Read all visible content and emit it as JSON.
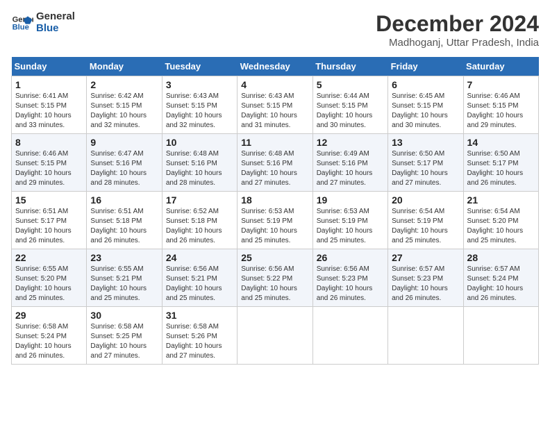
{
  "header": {
    "logo_line1": "General",
    "logo_line2": "Blue",
    "month_title": "December 2024",
    "location": "Madhoganj, Uttar Pradesh, India"
  },
  "weekdays": [
    "Sunday",
    "Monday",
    "Tuesday",
    "Wednesday",
    "Thursday",
    "Friday",
    "Saturday"
  ],
  "weeks": [
    [
      {
        "day": "1",
        "sunrise": "6:41 AM",
        "sunset": "5:15 PM",
        "daylight": "10 hours and 33 minutes."
      },
      {
        "day": "2",
        "sunrise": "6:42 AM",
        "sunset": "5:15 PM",
        "daylight": "10 hours and 32 minutes."
      },
      {
        "day": "3",
        "sunrise": "6:43 AM",
        "sunset": "5:15 PM",
        "daylight": "10 hours and 32 minutes."
      },
      {
        "day": "4",
        "sunrise": "6:43 AM",
        "sunset": "5:15 PM",
        "daylight": "10 hours and 31 minutes."
      },
      {
        "day": "5",
        "sunrise": "6:44 AM",
        "sunset": "5:15 PM",
        "daylight": "10 hours and 30 minutes."
      },
      {
        "day": "6",
        "sunrise": "6:45 AM",
        "sunset": "5:15 PM",
        "daylight": "10 hours and 30 minutes."
      },
      {
        "day": "7",
        "sunrise": "6:46 AM",
        "sunset": "5:15 PM",
        "daylight": "10 hours and 29 minutes."
      }
    ],
    [
      {
        "day": "8",
        "sunrise": "6:46 AM",
        "sunset": "5:15 PM",
        "daylight": "10 hours and 29 minutes."
      },
      {
        "day": "9",
        "sunrise": "6:47 AM",
        "sunset": "5:16 PM",
        "daylight": "10 hours and 28 minutes."
      },
      {
        "day": "10",
        "sunrise": "6:48 AM",
        "sunset": "5:16 PM",
        "daylight": "10 hours and 28 minutes."
      },
      {
        "day": "11",
        "sunrise": "6:48 AM",
        "sunset": "5:16 PM",
        "daylight": "10 hours and 27 minutes."
      },
      {
        "day": "12",
        "sunrise": "6:49 AM",
        "sunset": "5:16 PM",
        "daylight": "10 hours and 27 minutes."
      },
      {
        "day": "13",
        "sunrise": "6:50 AM",
        "sunset": "5:17 PM",
        "daylight": "10 hours and 27 minutes."
      },
      {
        "day": "14",
        "sunrise": "6:50 AM",
        "sunset": "5:17 PM",
        "daylight": "10 hours and 26 minutes."
      }
    ],
    [
      {
        "day": "15",
        "sunrise": "6:51 AM",
        "sunset": "5:17 PM",
        "daylight": "10 hours and 26 minutes."
      },
      {
        "day": "16",
        "sunrise": "6:51 AM",
        "sunset": "5:18 PM",
        "daylight": "10 hours and 26 minutes."
      },
      {
        "day": "17",
        "sunrise": "6:52 AM",
        "sunset": "5:18 PM",
        "daylight": "10 hours and 26 minutes."
      },
      {
        "day": "18",
        "sunrise": "6:53 AM",
        "sunset": "5:19 PM",
        "daylight": "10 hours and 25 minutes."
      },
      {
        "day": "19",
        "sunrise": "6:53 AM",
        "sunset": "5:19 PM",
        "daylight": "10 hours and 25 minutes."
      },
      {
        "day": "20",
        "sunrise": "6:54 AM",
        "sunset": "5:19 PM",
        "daylight": "10 hours and 25 minutes."
      },
      {
        "day": "21",
        "sunrise": "6:54 AM",
        "sunset": "5:20 PM",
        "daylight": "10 hours and 25 minutes."
      }
    ],
    [
      {
        "day": "22",
        "sunrise": "6:55 AM",
        "sunset": "5:20 PM",
        "daylight": "10 hours and 25 minutes."
      },
      {
        "day": "23",
        "sunrise": "6:55 AM",
        "sunset": "5:21 PM",
        "daylight": "10 hours and 25 minutes."
      },
      {
        "day": "24",
        "sunrise": "6:56 AM",
        "sunset": "5:21 PM",
        "daylight": "10 hours and 25 minutes."
      },
      {
        "day": "25",
        "sunrise": "6:56 AM",
        "sunset": "5:22 PM",
        "daylight": "10 hours and 25 minutes."
      },
      {
        "day": "26",
        "sunrise": "6:56 AM",
        "sunset": "5:23 PM",
        "daylight": "10 hours and 26 minutes."
      },
      {
        "day": "27",
        "sunrise": "6:57 AM",
        "sunset": "5:23 PM",
        "daylight": "10 hours and 26 minutes."
      },
      {
        "day": "28",
        "sunrise": "6:57 AM",
        "sunset": "5:24 PM",
        "daylight": "10 hours and 26 minutes."
      }
    ],
    [
      {
        "day": "29",
        "sunrise": "6:58 AM",
        "sunset": "5:24 PM",
        "daylight": "10 hours and 26 minutes."
      },
      {
        "day": "30",
        "sunrise": "6:58 AM",
        "sunset": "5:25 PM",
        "daylight": "10 hours and 27 minutes."
      },
      {
        "day": "31",
        "sunrise": "6:58 AM",
        "sunset": "5:26 PM",
        "daylight": "10 hours and 27 minutes."
      },
      null,
      null,
      null,
      null
    ]
  ]
}
